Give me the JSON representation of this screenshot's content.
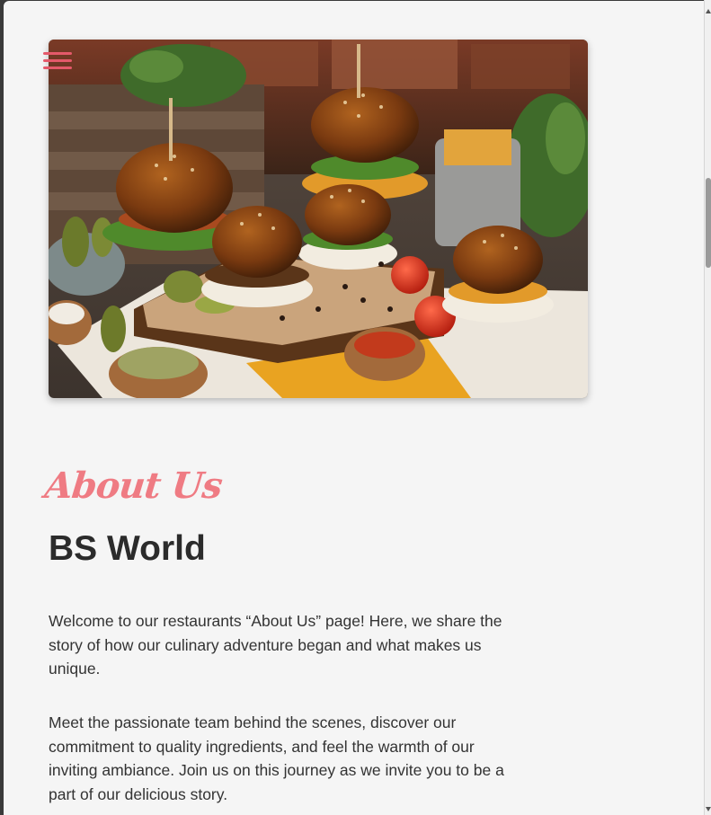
{
  "nav": {
    "menu_icon": "hamburger-menu-icon",
    "menu_color": "#e5596a"
  },
  "hero": {
    "image_icon": "burgers-photo"
  },
  "about": {
    "script_heading": "About Us",
    "title": "BS World",
    "paragraphs": [
      "Welcome to our restaurants “About Us” page! Here, we share the story of how our culinary adventure began and what makes us unique.",
      "Meet the passionate team behind the scenes, discover our commitment to quality ingredients, and feel the warmth of our inviting ambiance. Join us on this journey as we invite you to be a part of our delicious story."
    ]
  },
  "colors": {
    "accent": "#ef7b83",
    "text": "#333333",
    "heading": "#2b2b2b",
    "background": "#f5f5f5"
  }
}
